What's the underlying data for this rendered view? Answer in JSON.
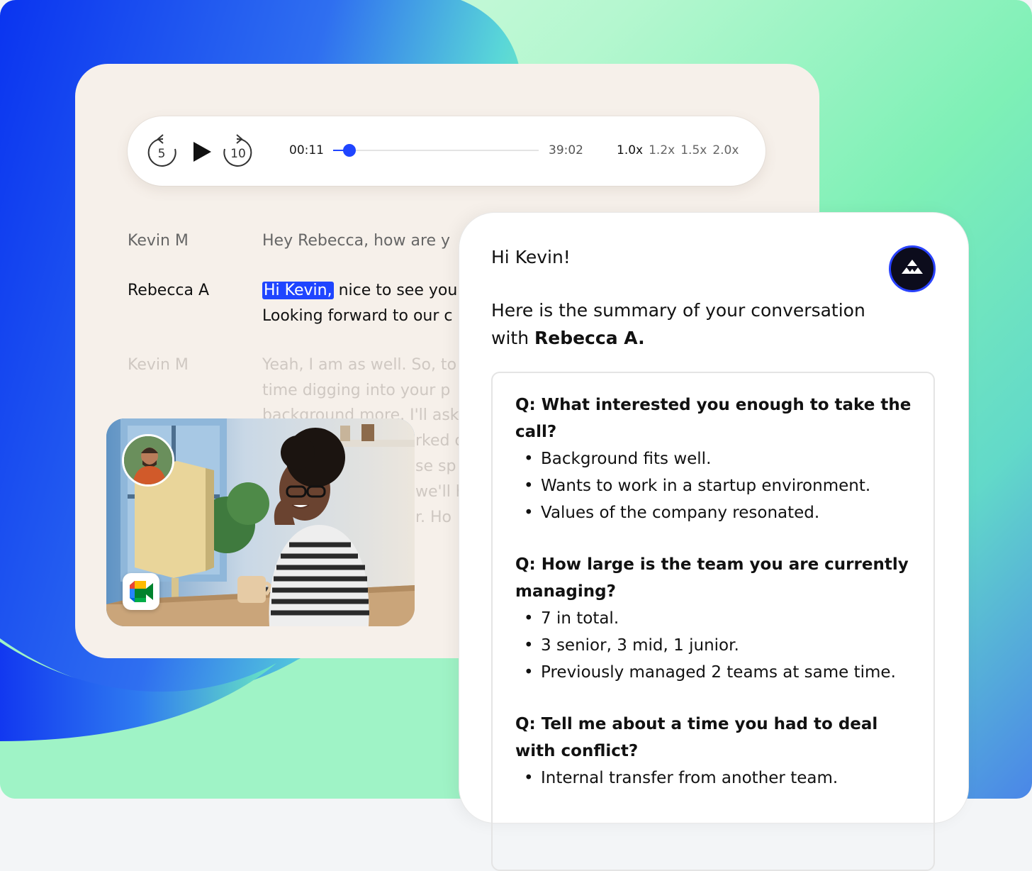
{
  "player": {
    "rewind_seconds": "5",
    "forward_seconds": "10",
    "current_time": "00:11",
    "total_time": "39:02",
    "progress": 0.08,
    "speeds": [
      "1.0x",
      "1.2x",
      "1.5x",
      "2.0x"
    ],
    "active_speed": "1.0x"
  },
  "transcript": {
    "lines": [
      {
        "speaker": "Kevin M",
        "text": "Hey Rebecca, how are y"
      },
      {
        "speaker": "Rebecca A",
        "highlight": "Hi Kevin,",
        "text": " nice to see you",
        "text2": "Looking forward to our c"
      },
      {
        "speaker": "Kevin M",
        "text": "Yeah, I am as well. So, to",
        "text2": "time digging into your p",
        "text3": "background more. I'll ask",
        "text4": "rked o",
        "text5": "se sp",
        "text6": "we'll h",
        "text7": "r. Ho"
      }
    ]
  },
  "summary": {
    "greeting": "Hi Kevin!",
    "intro_prefix": "Here is the summary of your conversation with ",
    "intro_name": "Rebecca A.",
    "qa": [
      {
        "q": "Q:  What interested you enough to take the call?",
        "a": [
          "Background fits well.",
          "Wants to work in a startup environment.",
          "Values of the company resonated."
        ]
      },
      {
        "q": "Q: How large is the team you are currently managing?",
        "a": [
          "7 in total.",
          "3 senior, 3 mid, 1 junior.",
          "Previously managed 2 teams at same time."
        ]
      },
      {
        "q": "Q: Tell me about a time you had to deal with conflict?",
        "a": [
          "Internal transfer from another team."
        ]
      }
    ]
  },
  "colors": {
    "accent": "#1f45ff",
    "card": "#f6f0ea"
  }
}
